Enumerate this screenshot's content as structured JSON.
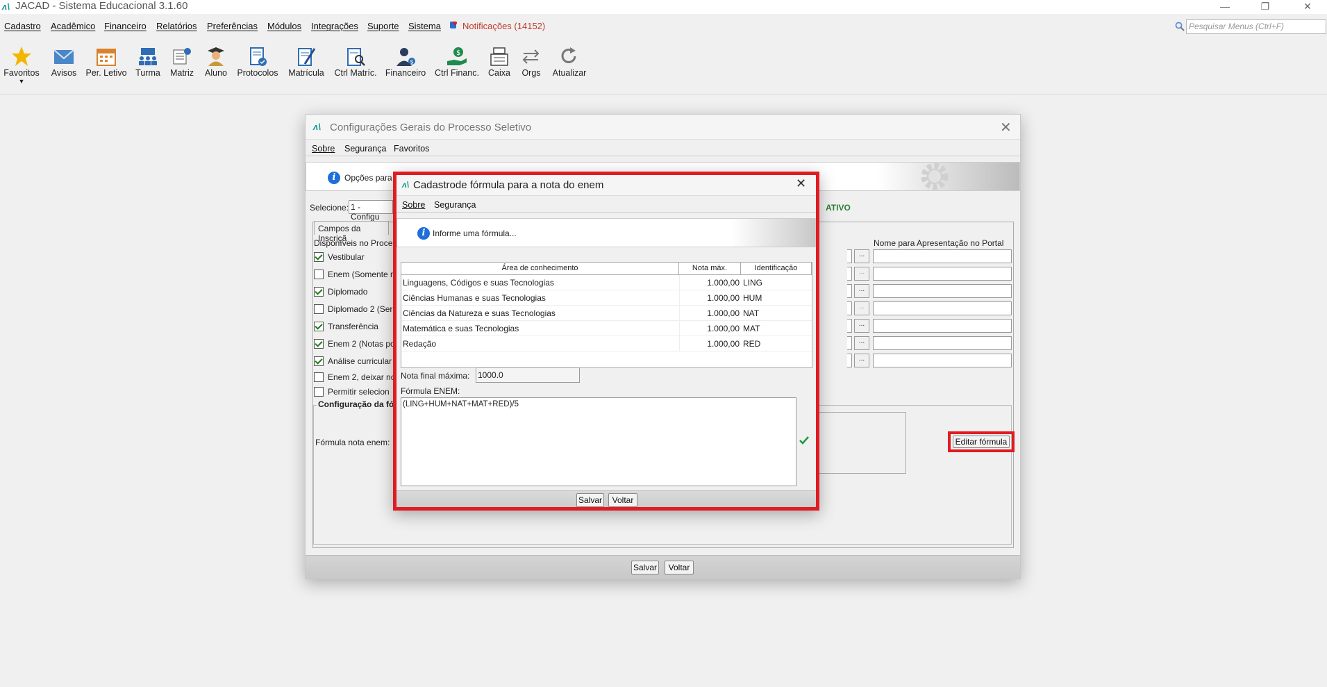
{
  "app": {
    "title": "JACAD - Sistema Educacional 3.1.60",
    "min_glyph": "—",
    "restore_glyph": "❐",
    "close_glyph": "✕"
  },
  "menu": {
    "items": [
      "Cadastro",
      "Acadêmico",
      "Financeiro",
      "Relatórios",
      "Preferências",
      "Módulos",
      "Integrações",
      "Suporte",
      "Sistema"
    ],
    "notifications": "Notificações (14152)",
    "search_placeholder": "Pesquisar Menus (Ctrl+F)"
  },
  "toolbar": {
    "buttons": [
      "Favoritos",
      "Avisos",
      "Per. Letivo",
      "Turma",
      "Matriz",
      "Aluno",
      "Protocolos",
      "Matrícula",
      "Ctrl Matríc.",
      "Financeiro",
      "Ctrl Financ.",
      "Caixa",
      "Orgs",
      "Atualizar"
    ]
  },
  "main_dialog": {
    "title": "Configurações Gerais do Processo Seletivo",
    "menu": [
      "Sobre",
      "Segurança",
      "Favoritos"
    ],
    "banner_text": "Opções para",
    "select_label": "Selecione:",
    "select_value": "1 - Configu",
    "status": "ATIVO",
    "tab": "Campos da Inscriçã",
    "col_available": "Disponíveis no Proces",
    "col_portal_name": "Nome para Apresentação no Portal",
    "options": [
      {
        "label": "Vestibular",
        "checked": true
      },
      {
        "label": "Enem (Somente n",
        "checked": false
      },
      {
        "label": "Diplomado",
        "checked": true
      },
      {
        "label": "Diplomado 2 (Sera",
        "checked": false
      },
      {
        "label": "Transferência",
        "checked": true
      },
      {
        "label": "Enem 2 (Notas po",
        "checked": true
      },
      {
        "label": "Análise curricular",
        "checked": true
      },
      {
        "label": "Enem 2, deixar no",
        "checked": false
      },
      {
        "label": "Permitir selecion",
        "checked": false
      }
    ],
    "ellipsis": "...",
    "formula_group": "Configuração da fór",
    "formula_label": "Fórmula nota enem:",
    "edit_formula_button": "Editar fórmula",
    "save_button": "Salvar",
    "back_button": "Voltar"
  },
  "formula_dialog": {
    "title": "Cadastrode fórmula para a nota do enem",
    "menu": [
      "Sobre",
      "Segurança"
    ],
    "banner_text": "Informe uma fórmula...",
    "columns": [
      "Área de conhecimento",
      "Nota máx.",
      "Identificação"
    ],
    "rows": [
      {
        "area": "Linguagens, Códigos e suas Tecnologias",
        "max": "1.000,00",
        "id": "LING"
      },
      {
        "area": "Ciências Humanas e suas Tecnologias",
        "max": "1.000,00",
        "id": "HUM"
      },
      {
        "area": "Ciências da Natureza e suas Tecnologias",
        "max": "1.000,00",
        "id": "NAT"
      },
      {
        "area": "Matemática e suas Tecnologias",
        "max": "1.000,00",
        "id": "MAT"
      },
      {
        "area": "Redação",
        "max": "1.000,00",
        "id": "RED"
      }
    ],
    "max_label": "Nota final máxima:",
    "max_value": "1000.0",
    "formula_label": "Fórmula ENEM:",
    "formula_value": "(LING+HUM+NAT+MAT+RED)/5",
    "save_button": "Salvar",
    "back_button": "Voltar"
  },
  "colors": {
    "highlight": "#e01b22",
    "status": "#2e7d32",
    "notification": "#c0392b",
    "brand": "#159a8f"
  }
}
